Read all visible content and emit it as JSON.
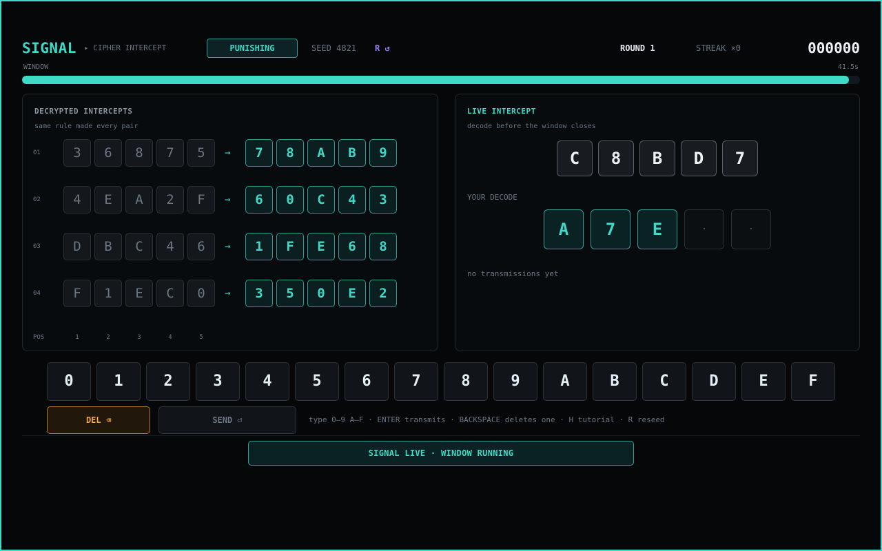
{
  "header": {
    "logo": "SIGNAL",
    "subtitle": "▸ CIPHER INTERCEPT",
    "mode_label": "PUNISHING",
    "seed": "SEED 4821",
    "reseed": "R ↺",
    "round": "ROUND 1",
    "streak": "STREAK ×0",
    "score": "000000"
  },
  "window": {
    "label": "WINDOW",
    "time": "41.5s",
    "fraction": 0.987
  },
  "intercepts": {
    "title": "DECRYPTED INTERCEPTS",
    "subtitle": "same rule made every pair",
    "arrow": "→",
    "rows": [
      {
        "num": "01",
        "input": [
          "3",
          "6",
          "8",
          "7",
          "5"
        ],
        "output": [
          "7",
          "8",
          "A",
          "B",
          "9"
        ]
      },
      {
        "num": "02",
        "input": [
          "4",
          "E",
          "A",
          "2",
          "F"
        ],
        "output": [
          "6",
          "0",
          "C",
          "4",
          "3"
        ]
      },
      {
        "num": "03",
        "input": [
          "D",
          "B",
          "C",
          "4",
          "6"
        ],
        "output": [
          "1",
          "F",
          "E",
          "6",
          "8"
        ]
      },
      {
        "num": "04",
        "input": [
          "F",
          "1",
          "E",
          "C",
          "0"
        ],
        "output": [
          "3",
          "5",
          "0",
          "E",
          "2"
        ]
      }
    ],
    "pos_label": "POS",
    "positions": [
      "1",
      "2",
      "3",
      "4",
      "5"
    ]
  },
  "live": {
    "title": "LIVE INTERCEPT",
    "subtitle": "decode before the window closes",
    "cipher": [
      "C",
      "8",
      "B",
      "D",
      "7"
    ],
    "decode_label": "YOUR DECODE",
    "decode": [
      "A",
      "7",
      "E",
      "·",
      "·"
    ],
    "history": "no transmissions yet"
  },
  "keypad": {
    "keys": [
      "0",
      "1",
      "2",
      "3",
      "4",
      "5",
      "6",
      "7",
      "8",
      "9",
      "A",
      "B",
      "C",
      "D",
      "E",
      "F"
    ],
    "del_label": "DEL  ⌫",
    "send_label": "SEND  ⏎",
    "hint": "type 0–9 A–F  ·  ENTER transmits  ·  BACKSPACE deletes one  ·  H tutorial  ·  R reseed"
  },
  "status": "SIGNAL LIVE · WINDOW RUNNING",
  "colors": {
    "accent": "#3fd9c8",
    "warning": "#f0a84a",
    "reseed": "#9b7ff0",
    "background": "#050709"
  }
}
